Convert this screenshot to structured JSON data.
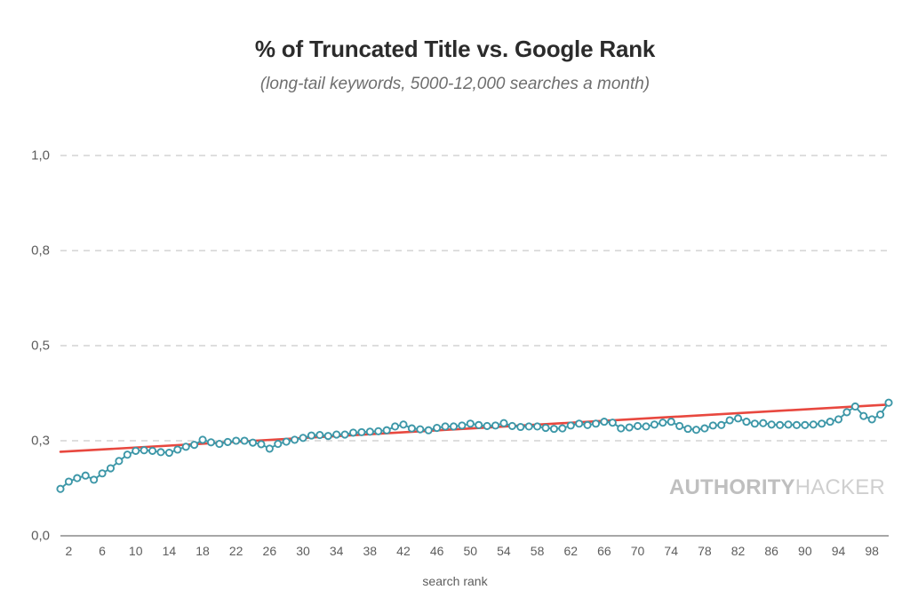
{
  "chart_data": {
    "type": "line",
    "title": "% of Truncated Title vs. Google Rank",
    "subtitle": "(long-tail keywords, 5000-12,000 searches a month)",
    "xlabel": "search rank",
    "ylabel": "",
    "grid": true,
    "legend": false,
    "y_ticks": [
      "1,0",
      "0,8",
      "0,5",
      "0,3",
      "0,0"
    ],
    "y_tick_values": [
      1.0,
      0.8,
      0.5,
      0.3,
      0.0
    ],
    "y_axis_note": "ordinal gridline spacing - ticks evenly spaced in pixels",
    "x_ticks": [
      2,
      6,
      10,
      14,
      18,
      22,
      26,
      30,
      34,
      38,
      42,
      46,
      50,
      54,
      58,
      62,
      66,
      70,
      74,
      78,
      82,
      86,
      90,
      94,
      98
    ],
    "xlim": [
      1,
      100
    ],
    "x": [
      1,
      2,
      3,
      4,
      5,
      6,
      7,
      8,
      9,
      10,
      11,
      12,
      13,
      14,
      15,
      16,
      17,
      18,
      19,
      20,
      21,
      22,
      23,
      24,
      25,
      26,
      27,
      28,
      29,
      30,
      31,
      32,
      33,
      34,
      35,
      36,
      37,
      38,
      39,
      40,
      41,
      42,
      43,
      44,
      45,
      46,
      47,
      48,
      49,
      50,
      51,
      52,
      53,
      54,
      55,
      56,
      57,
      58,
      59,
      60,
      61,
      62,
      63,
      64,
      65,
      66,
      67,
      68,
      69,
      70,
      71,
      72,
      73,
      74,
      75,
      76,
      77,
      78,
      79,
      80,
      81,
      82,
      83,
      84,
      85,
      86,
      87,
      88,
      89,
      90,
      91,
      92,
      93,
      94,
      95,
      96,
      97,
      98,
      99,
      100
    ],
    "series": [
      {
        "name": "% of truncated title",
        "color": "#3d97a8",
        "marker": "open-circle",
        "values": [
          0.148,
          0.171,
          0.182,
          0.19,
          0.177,
          0.197,
          0.213,
          0.236,
          0.256,
          0.268,
          0.27,
          0.268,
          0.264,
          0.262,
          0.272,
          0.281,
          0.287,
          0.302,
          0.295,
          0.29,
          0.296,
          0.3,
          0.3,
          0.294,
          0.289,
          0.275,
          0.29,
          0.297,
          0.302,
          0.306,
          0.311,
          0.312,
          0.31,
          0.313,
          0.313,
          0.317,
          0.318,
          0.319,
          0.32,
          0.322,
          0.33,
          0.334,
          0.326,
          0.324,
          0.322,
          0.327,
          0.33,
          0.33,
          0.332,
          0.336,
          0.333,
          0.331,
          0.332,
          0.337,
          0.331,
          0.329,
          0.33,
          0.33,
          0.327,
          0.325,
          0.326,
          0.332,
          0.336,
          0.333,
          0.336,
          0.34,
          0.338,
          0.326,
          0.328,
          0.331,
          0.33,
          0.334,
          0.338,
          0.34,
          0.331,
          0.325,
          0.323,
          0.326,
          0.332,
          0.333,
          0.343,
          0.347,
          0.34,
          0.336,
          0.337,
          0.334,
          0.333,
          0.334,
          0.333,
          0.333,
          0.334,
          0.336,
          0.34,
          0.345,
          0.36,
          0.372,
          0.352,
          0.345,
          0.355,
          0.38
        ]
      }
    ],
    "trendline": {
      "name": "linear trend",
      "color": "#e8483f",
      "start_value": 0.265,
      "end_value": 0.376
    }
  },
  "watermark": {
    "bold_text": "AUTHORITY",
    "light_text": "HACKER"
  },
  "colors": {
    "series": "#3d97a8",
    "trend": "#e8483f",
    "grid": "#c9c9c9",
    "axis": "#8a8a8a",
    "text": "#5d5d5d",
    "title": "#2b2b2b",
    "background": "#ffffff"
  }
}
